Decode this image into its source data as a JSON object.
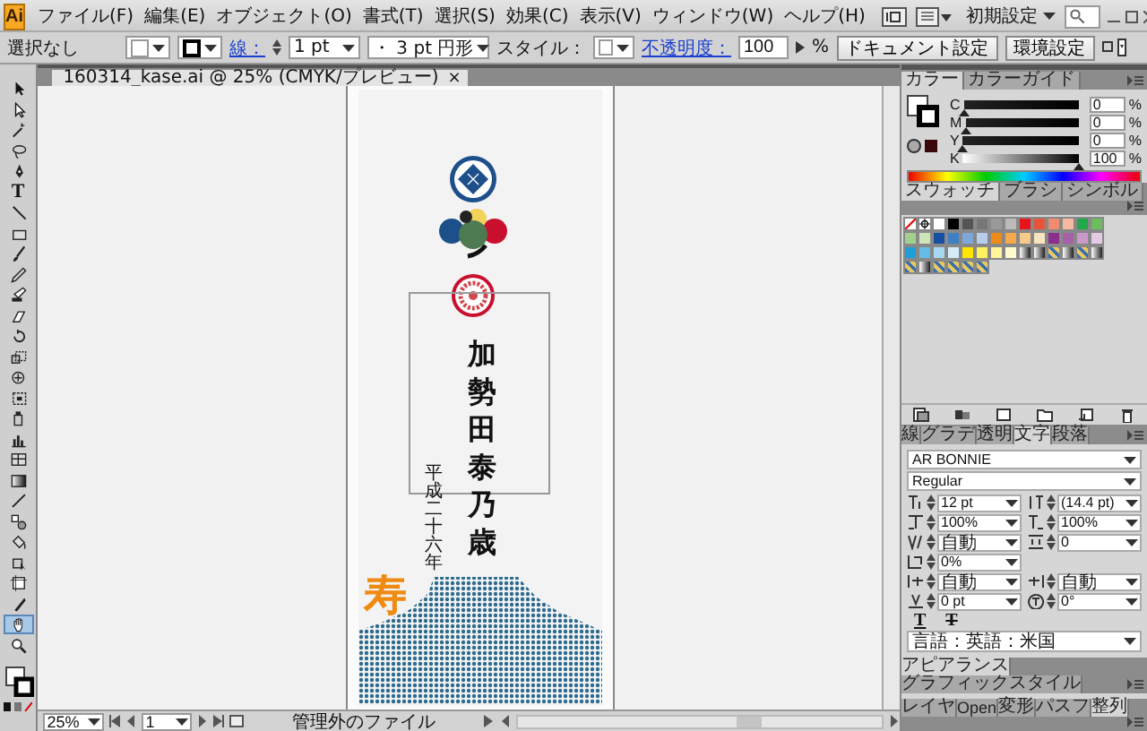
{
  "app": {
    "logo": "Ai"
  },
  "menu": [
    {
      "label": "ファイル(F)"
    },
    {
      "label": "編集(E)"
    },
    {
      "label": "オブジェクト(O)"
    },
    {
      "label": "書式(T)"
    },
    {
      "label": "選択(S)"
    },
    {
      "label": "効果(C)"
    },
    {
      "label": "表示(V)"
    },
    {
      "label": "ウィンドウ(W)"
    },
    {
      "label": "ヘルプ(H)"
    }
  ],
  "workspace": {
    "label": "初期設定"
  },
  "control_bar": {
    "selection": "選択なし",
    "stroke_label": "線：",
    "stroke_weight": "1 pt",
    "brush": "・ 3 pt 円形",
    "style_label": "スタイル：",
    "opacity_label": "不透明度：",
    "opacity": "100",
    "percent": "%",
    "buttons": [
      "ドキュメント設定",
      "環境設定"
    ]
  },
  "document_tab": {
    "title": "160314_kase.ai @ 25% (CMYK/プレビュー)",
    "close": "×"
  },
  "toolbox": {
    "tools": [
      {
        "kind": "selection",
        "selected": false
      },
      {
        "kind": "direct",
        "selected": false
      },
      {
        "kind": "wand",
        "selected": false
      },
      {
        "kind": "lasso",
        "selected": false
      },
      {
        "kind": "pen",
        "selected": false
      },
      {
        "kind": "type",
        "label": "T",
        "selected": false
      },
      {
        "kind": "line",
        "selected": false
      },
      {
        "kind": "rect",
        "selected": false
      },
      {
        "kind": "brush",
        "selected": false
      },
      {
        "kind": "pencil",
        "selected": false
      },
      {
        "kind": "blob",
        "selected": false
      },
      {
        "kind": "eraser",
        "selected": false
      },
      {
        "kind": "rotate",
        "selected": false
      },
      {
        "kind": "scale",
        "selected": false
      },
      {
        "kind": "warp",
        "selected": false
      },
      {
        "kind": "transform",
        "selected": false
      },
      {
        "kind": "sprayer",
        "selected": false
      },
      {
        "kind": "graph",
        "selected": false
      },
      {
        "kind": "mesh",
        "selected": false
      },
      {
        "kind": "gradient",
        "selected": false
      },
      {
        "kind": "eyedropper",
        "selected": false
      },
      {
        "kind": "blend",
        "selected": false
      },
      {
        "kind": "livepaint",
        "selected": false
      },
      {
        "kind": "livepaintselect",
        "selected": false
      },
      {
        "kind": "artboard",
        "selected": false
      },
      {
        "kind": "slice",
        "selected": false
      },
      {
        "kind": "hand",
        "selected": true
      },
      {
        "kind": "zoom",
        "selected": false
      }
    ]
  },
  "artwork": {
    "calligraphy": "加勢田泰乃歳",
    "date": "平成二十六年",
    "kotobuki": "寿"
  },
  "color_panel": {
    "tabs": [
      {
        "label": "カラー",
        "selected": true
      },
      {
        "label": "カラーガイド",
        "selected": false
      }
    ],
    "channels": [
      {
        "name": "C",
        "value": "0",
        "unit": "%",
        "level": 0
      },
      {
        "name": "M",
        "value": "0",
        "unit": "%",
        "level": 0
      },
      {
        "name": "Y",
        "value": "0",
        "unit": "%",
        "level": 0
      },
      {
        "name": "K",
        "value": "100",
        "unit": "%",
        "level": 1
      }
    ]
  },
  "swatches_panel": {
    "tabs": [
      {
        "label": "スウォッチ",
        "selected": true
      },
      {
        "label": "ブラシ",
        "selected": false
      },
      {
        "label": "シンボル",
        "selected": false
      }
    ],
    "swatches": [
      {
        "kind": "none"
      },
      {
        "kind": "registration"
      },
      {
        "kind": "color",
        "color": "#ffffff"
      },
      {
        "kind": "color",
        "color": "#000000"
      },
      {
        "kind": "color",
        "color": "#555555"
      },
      {
        "kind": "color",
        "color": "#777777"
      },
      {
        "kind": "color",
        "color": "#999999"
      },
      {
        "kind": "color",
        "color": "#bbbbbb"
      },
      {
        "kind": "color",
        "color": "#e8141c"
      },
      {
        "kind": "color",
        "color": "#e6553a"
      },
      {
        "kind": "color",
        "color": "#f08c6e"
      },
      {
        "kind": "color",
        "color": "#f5b9a0"
      },
      {
        "kind": "color",
        "color": "#22a84a"
      },
      {
        "kind": "color",
        "color": "#6cbd5c"
      },
      {
        "kind": "color",
        "color": "#a3d08d"
      },
      {
        "kind": "color",
        "color": "#cfe5b8"
      },
      {
        "kind": "color",
        "color": "#1750a0"
      },
      {
        "kind": "color",
        "color": "#3f7fc4"
      },
      {
        "kind": "color",
        "color": "#7ea8d8"
      },
      {
        "kind": "color",
        "color": "#b8cde9"
      },
      {
        "kind": "color",
        "color": "#ee8a18"
      },
      {
        "kind": "color",
        "color": "#f4a94a"
      },
      {
        "kind": "color",
        "color": "#f7c98b"
      },
      {
        "kind": "color",
        "color": "#fbe3bf"
      },
      {
        "kind": "color",
        "color": "#8c2f8c"
      },
      {
        "kind": "color",
        "color": "#a861a8"
      },
      {
        "kind": "color",
        "color": "#c99ac9"
      },
      {
        "kind": "color",
        "color": "#e4cbe4"
      },
      {
        "kind": "color",
        "color": "#1e9fd8"
      },
      {
        "kind": "color",
        "color": "#64bbe6"
      },
      {
        "kind": "color",
        "color": "#a7d8f1"
      },
      {
        "kind": "color",
        "color": "#d5ecf8"
      },
      {
        "kind": "color",
        "color": "#ffe500"
      },
      {
        "kind": "color",
        "color": "#fff060"
      },
      {
        "kind": "color",
        "color": "#fff59c"
      },
      {
        "kind": "color",
        "color": "#fffad0"
      },
      {
        "kind": "gradient"
      },
      {
        "kind": "gradient"
      },
      {
        "kind": "pattern"
      },
      {
        "kind": "gradient"
      },
      {
        "kind": "pattern"
      },
      {
        "kind": "gradient"
      },
      {
        "kind": "pattern"
      },
      {
        "kind": "gradient"
      },
      {
        "kind": "pattern"
      },
      {
        "kind": "pattern"
      },
      {
        "kind": "pattern"
      },
      {
        "kind": "pattern"
      }
    ]
  },
  "character_panel": {
    "tabs": [
      {
        "label": "線",
        "selected": false
      },
      {
        "label": "グラデ",
        "selected": false
      },
      {
        "label": "透明",
        "selected": false
      },
      {
        "label": "文字",
        "selected": true
      },
      {
        "label": "段落",
        "selected": false
      }
    ],
    "font": "AR BONNIE",
    "style": "Regular",
    "fields": [
      {
        "kind": "size",
        "value": "12 pt"
      },
      {
        "kind": "leading",
        "value": "(14.4 pt)"
      },
      {
        "kind": "vscale",
        "value": "100%"
      },
      {
        "kind": "hscale",
        "value": "100%"
      },
      {
        "kind": "kerning",
        "value": "自動"
      },
      {
        "kind": "tracking",
        "value": "0"
      },
      {
        "kind": "tsume",
        "value": "0%"
      },
      {
        "kind": "aki_before",
        "value": "自動"
      },
      {
        "kind": "aki_after",
        "value": "自動"
      },
      {
        "kind": "baseline",
        "value": "0 pt"
      },
      {
        "kind": "rotation",
        "value": "0°"
      }
    ],
    "style_buttons": [
      {
        "kind": "underline",
        "label": "T"
      },
      {
        "kind": "strikethrough",
        "label": "T"
      }
    ],
    "language": "言語：英語：米国"
  },
  "appearance_panel": {
    "tabs": [
      {
        "label": "アピアランス",
        "selected": true
      },
      {
        "label": "グラフィックスタイル",
        "selected": false
      }
    ]
  },
  "layers_panel": {
    "tabs": [
      {
        "label": "レイヤ",
        "selected": false
      },
      {
        "label": "Open",
        "selected": false
      },
      {
        "label": "変形",
        "selected": false
      },
      {
        "label": "パスフ",
        "selected": false
      },
      {
        "label": "整列",
        "selected": true
      }
    ]
  },
  "status_bar": {
    "zoom": "25%",
    "page": "1",
    "status": "管理外のファイル"
  }
}
